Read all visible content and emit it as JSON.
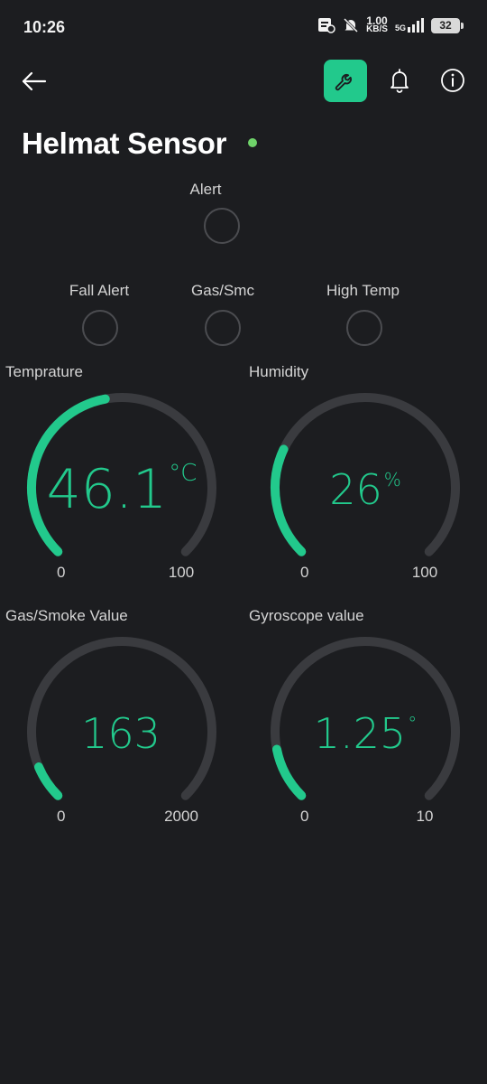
{
  "status_bar": {
    "time": "10:26",
    "net_speed": "1.00",
    "net_unit": "KB/S",
    "network": "5G",
    "battery": "32"
  },
  "header": {
    "title": "Helmat Sensor",
    "icons": [
      "back-arrow-icon",
      "wrench-icon",
      "bell-icon",
      "info-icon"
    ],
    "accent": "#22c98c",
    "online_color": "#6fd36a"
  },
  "alerts": {
    "main": {
      "label": "Alert"
    },
    "items": [
      {
        "label": "Fall Alert"
      },
      {
        "label": "Gas/Smc"
      },
      {
        "label": "High Temp"
      }
    ]
  },
  "gauges": [
    {
      "label": "Temprature",
      "value_text": "46.1",
      "unit": "°C",
      "value": 46.1,
      "min": 0,
      "max": 100,
      "min_label": "0",
      "max_label": "100"
    },
    {
      "label": "Humidity",
      "value_text": "26",
      "unit": "%",
      "value": 26,
      "min": 0,
      "max": 100,
      "min_label": "0",
      "max_label": "100"
    },
    {
      "label": "Gas/Smoke Value",
      "value_text": "163",
      "unit": "",
      "value": 163,
      "min": 0,
      "max": 2000,
      "min_label": "0",
      "max_label": "2000"
    },
    {
      "label": "Gyroscope value",
      "value_text": "1.25",
      "unit": "°",
      "value": 1.25,
      "min": 0,
      "max": 10,
      "min_label": "0",
      "max_label": "10"
    }
  ],
  "colors": {
    "gauge_fill": "#22c98c",
    "gauge_track": "#3a3b3f"
  }
}
